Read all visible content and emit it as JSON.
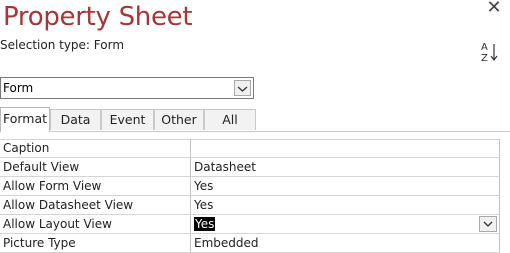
{
  "header": {
    "title": "Property Sheet",
    "selection_type": "Selection type:  Form"
  },
  "object_selector": {
    "value": "Form"
  },
  "tabs": [
    {
      "label": "Format",
      "active": true
    },
    {
      "label": "Data",
      "active": false
    },
    {
      "label": "Event",
      "active": false
    },
    {
      "label": "Other",
      "active": false
    },
    {
      "label": "All",
      "active": false
    }
  ],
  "properties": [
    {
      "name": "Caption",
      "value": ""
    },
    {
      "name": "Default View",
      "value": "Datasheet"
    },
    {
      "name": "Allow Form View",
      "value": "Yes"
    },
    {
      "name": "Allow Datasheet View",
      "value": "Yes"
    },
    {
      "name": "Allow Layout View",
      "value": "Yes"
    },
    {
      "name": "Picture Type",
      "value": "Embedded"
    }
  ],
  "icons": {
    "close": "close-icon",
    "sort": "sort-az-icon",
    "dropdown": "chevron-down-icon"
  },
  "colors": {
    "title": "#a4373a"
  }
}
